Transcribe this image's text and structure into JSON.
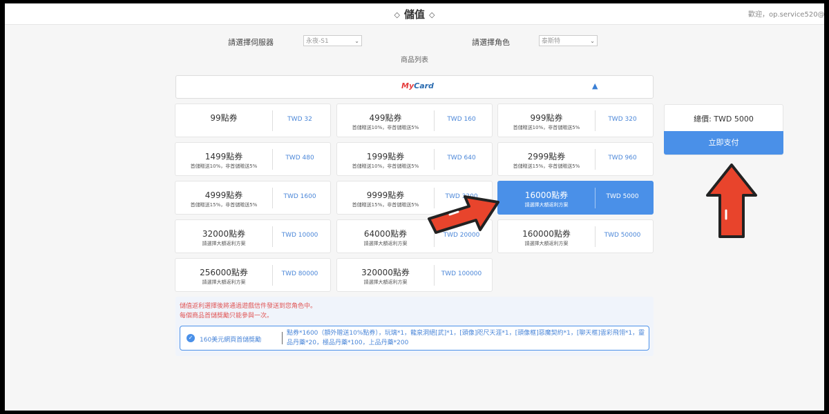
{
  "header": {
    "title": "儲值",
    "title_deco": "◇",
    "welcome": "歡迎，op.service520@gmail.com"
  },
  "filters": {
    "server_label": "請選擇伺服器",
    "server_value": "永夜-S1",
    "role_label": "請選擇角色",
    "role_value": "泰斯特"
  },
  "product_list_label": "商品列表",
  "payment_method": {
    "logo_prefix": "My",
    "logo_suffix": "Card",
    "collapse_icon": "▲"
  },
  "products": [
    {
      "name": "99點券",
      "sub": "",
      "price": "TWD 32"
    },
    {
      "name": "499點券",
      "sub": "首儲贈送10%，非首儲贈送5%",
      "price": "TWD 160"
    },
    {
      "name": "999點券",
      "sub": "首儲贈送10%，非首儲贈送5%",
      "price": "TWD 320"
    },
    {
      "name": "1499點券",
      "sub": "首儲贈送10%，非首儲贈送5%",
      "price": "TWD 480"
    },
    {
      "name": "1999點券",
      "sub": "首儲贈送10%，非首儲贈送5%",
      "price": "TWD 640"
    },
    {
      "name": "2999點券",
      "sub": "首儲贈送15%，非首儲贈送5%",
      "price": "TWD 960"
    },
    {
      "name": "4999點券",
      "sub": "首儲贈送15%，非首儲贈送5%",
      "price": "TWD 1600"
    },
    {
      "name": "9999點券",
      "sub": "首儲贈送15%，非首儲贈送5%",
      "price": "TWD 3200"
    },
    {
      "name": "16000點券",
      "sub": "請選擇大額返利方案",
      "price": "TWD 5000",
      "selected": true
    },
    {
      "name": "32000點券",
      "sub": "請選擇大額返利方案",
      "price": "TWD 10000"
    },
    {
      "name": "64000點券",
      "sub": "請選擇大額返利方案",
      "price": "TWD 20000"
    },
    {
      "name": "160000點券",
      "sub": "請選擇大額返利方案",
      "price": "TWD 50000"
    },
    {
      "name": "256000點券",
      "sub": "請選擇大額返利方案",
      "price": "TWD 80000"
    },
    {
      "name": "320000點券",
      "sub": "請選擇大額返利方案",
      "price": "TWD 100000"
    }
  ],
  "summary": {
    "total": "總價: TWD 5000",
    "pay_button": "立即支付"
  },
  "notice": {
    "line1": "儲值返利選擇後將通過遊戲信件發送到您角色中。",
    "line2": "每個商品首儲獎勵只能參與一次。"
  },
  "bonus": {
    "title": "160美元網頁首儲獎勵",
    "detail": "點券*1600（額外贈送10%點券），玩璃*1，龍泉洞絕[武]*1，[頭像]咫尺天涯*1，[頭像框]惡魔契約*1，[聊天框]雲彩飛翎*1，靈品丹藥*20，極品丹藥*100，上品丹藥*200"
  },
  "colors": {
    "accent": "#4a90e8",
    "notice_red": "#e05555",
    "arrow": "#e8442c"
  }
}
